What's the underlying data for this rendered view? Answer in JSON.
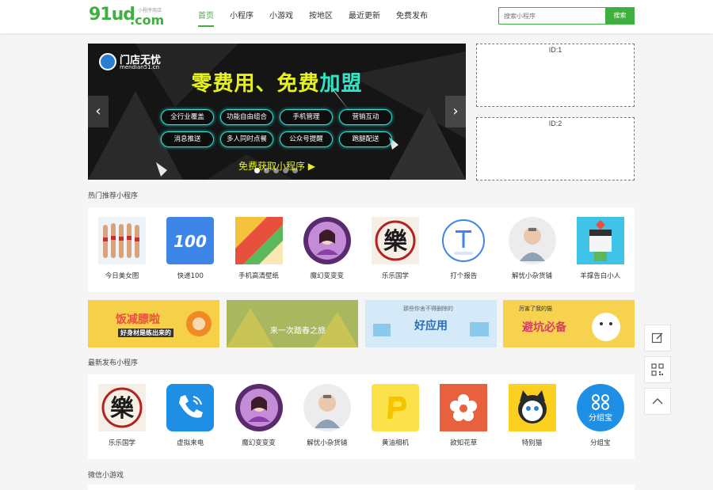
{
  "header": {
    "logo_main": "91ud",
    "logo_dot": ".com",
    "logo_tagline": "小程序商店",
    "nav": [
      "首页",
      "小程序",
      "小游戏",
      "按地区",
      "最近更新",
      "免费发布"
    ],
    "search_placeholder": "搜索小程序",
    "search_button": "搜索"
  },
  "banner": {
    "logo_name": "门店无忧",
    "logo_url": "mendian51.cn",
    "headline_a": "零费用、",
    "headline_b": "免费",
    "headline_c": "加盟",
    "pills": [
      "全行业覆盖",
      "功能自由组合",
      "手机管理",
      "营销互动",
      "消息推送",
      "多人同时点餐",
      "公众号提醒",
      "跑腿配送"
    ],
    "cta": "免费获取小程序 ▶",
    "prev": "‹",
    "next": "›",
    "dot_count": 5,
    "active_dot": 0
  },
  "ads": [
    "ID:1",
    "ID:2"
  ],
  "hot_section": {
    "title": "热门推荐小程序",
    "apps": [
      {
        "name": "今日美女图",
        "icon": "photo-models-icon"
      },
      {
        "name": "快递100",
        "icon": "kuaidi100-icon"
      },
      {
        "name": "手机高清壁纸",
        "icon": "wallpaper-icon"
      },
      {
        "name": "魔幻变变变",
        "icon": "magic-portrait-icon"
      },
      {
        "name": "乐乐国学",
        "icon": "yue-character-icon"
      },
      {
        "name": "打个报告",
        "icon": "report-t-icon"
      },
      {
        "name": "解忧小杂货铺",
        "icon": "old-man-icon"
      },
      {
        "name": "羊撑告白小人",
        "icon": "confession-figure-icon"
      }
    ]
  },
  "promos": [
    {
      "text": "饭减膘啦",
      "sub": "好身材是练出来的"
    },
    {
      "text": "来一次踏春之旅",
      "sub": ""
    },
    {
      "text": "好应用",
      "sub": "那些你舍不得删除的"
    },
    {
      "text": "避坑必备",
      "sub": "厉害了我的猫"
    }
  ],
  "latest_section": {
    "title": "最新发布小程序",
    "apps": [
      {
        "name": "乐乐国学",
        "icon": "yue-character-icon"
      },
      {
        "name": "虚拟来电",
        "icon": "phone-call-icon"
      },
      {
        "name": "魔幻变变变",
        "icon": "magic-portrait-icon"
      },
      {
        "name": "解忧小杂货铺",
        "icon": "old-man-icon"
      },
      {
        "name": "黄油相机",
        "icon": "butter-camera-icon"
      },
      {
        "name": "欲知花草",
        "icon": "flower-icon"
      },
      {
        "name": "特别猫",
        "icon": "cat-icon"
      },
      {
        "name": "分组宝",
        "icon": "group-tool-icon"
      }
    ]
  },
  "games_section": {
    "title": "微信小游戏"
  },
  "side_tools": [
    "edit-icon",
    "qrcode-icon",
    "back-to-top-icon"
  ],
  "colors": {
    "brand_green": "#3fb03f",
    "banner_yellow": "#e6f218",
    "banner_cyan": "#2de7c8"
  }
}
